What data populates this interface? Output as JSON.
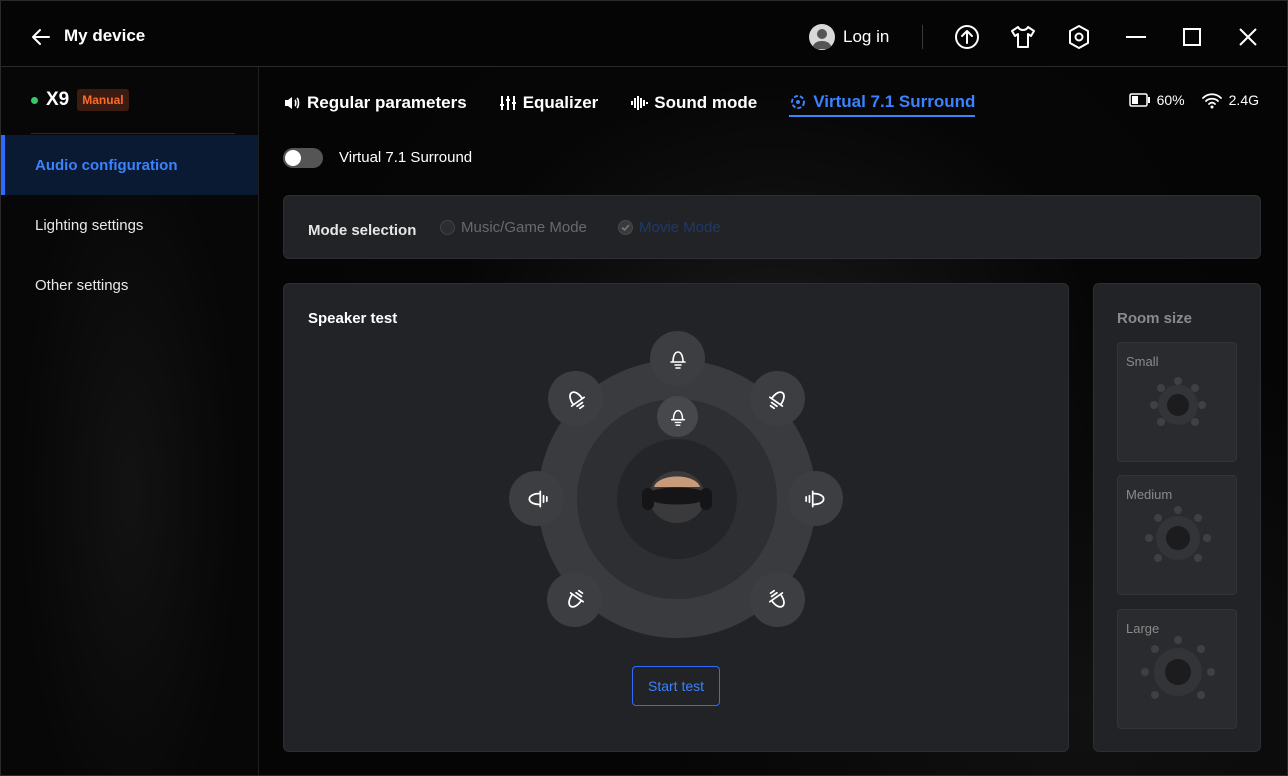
{
  "titlebar": {
    "title": "My device",
    "login_label": "Log in"
  },
  "device": {
    "name": "X9",
    "badge": "Manual",
    "status_color": "#3cc46a"
  },
  "sidebar": {
    "items": [
      {
        "label": "Audio configuration",
        "active": true
      },
      {
        "label": "Lighting settings",
        "active": false
      },
      {
        "label": "Other settings",
        "active": false
      }
    ]
  },
  "tabs": [
    {
      "label": "Regular parameters",
      "icon": "speaker-icon"
    },
    {
      "label": "Equalizer",
      "icon": "sliders-icon"
    },
    {
      "label": "Sound mode",
      "icon": "soundwave-icon"
    },
    {
      "label": "Virtual 7.1 Surround",
      "icon": "surround-icon",
      "active": true
    }
  ],
  "status": {
    "battery": "60%",
    "wireless": "2.4G"
  },
  "surround_toggle": {
    "label": "Virtual 7.1 Surround",
    "on": false
  },
  "mode_selection": {
    "title": "Mode selection",
    "options": [
      {
        "label": "Music/Game Mode",
        "selected": false
      },
      {
        "label": "Movie Mode",
        "selected": true
      }
    ]
  },
  "speaker_test": {
    "title": "Speaker test",
    "button_label": "Start test",
    "speakers": [
      "front-left",
      "front-center",
      "front-right",
      "side-left",
      "side-right",
      "rear-left",
      "rear-right",
      "subwoofer-center"
    ]
  },
  "room_size": {
    "title": "Room size",
    "options": [
      {
        "label": "Small"
      },
      {
        "label": "Medium"
      },
      {
        "label": "Large"
      }
    ]
  },
  "colors": {
    "accent": "#3b82ff",
    "badge_text": "#ff6a2a",
    "panel_bg": "#222326"
  }
}
